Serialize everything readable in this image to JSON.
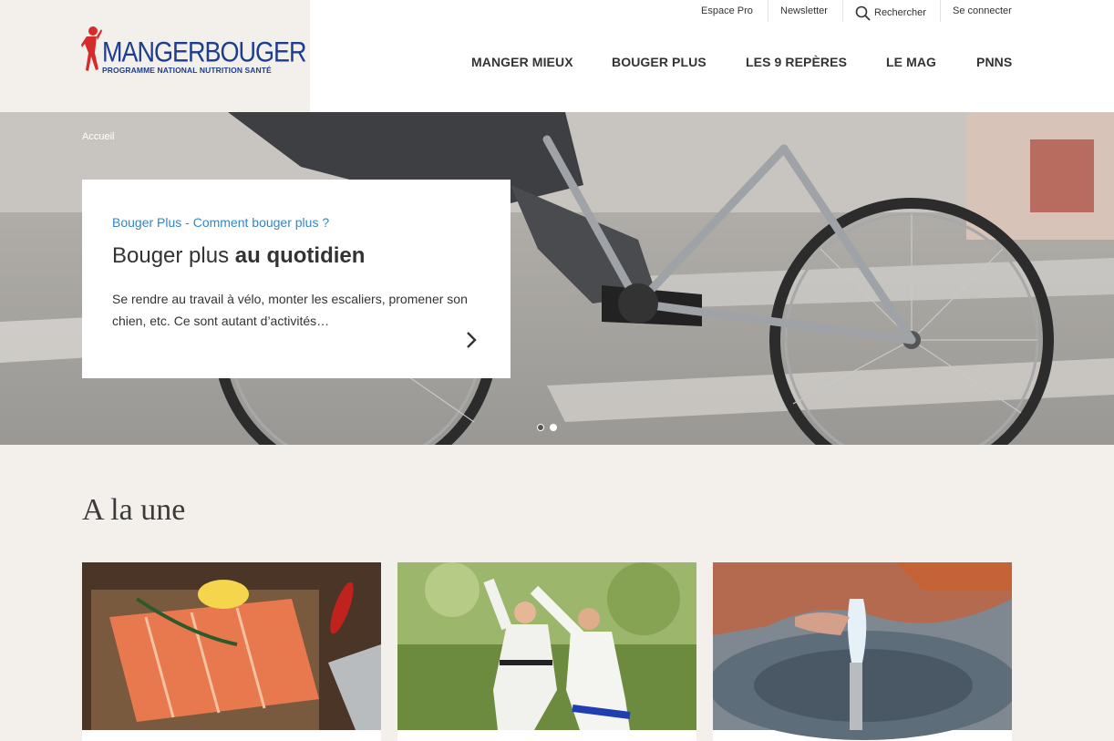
{
  "header": {
    "logo": {
      "title": "MANGERBOUGER",
      "subtitle": "PROGRAMME NATIONAL NUTRITION SANTÉ"
    },
    "utility": {
      "espace_pro": "Espace Pro",
      "newsletter": "Newsletter",
      "search": "Rechercher",
      "login": "Se connecter"
    },
    "nav": [
      "MANGER MIEUX",
      "BOUGER PLUS",
      "LES 9 REPÈRES",
      "LE MAG",
      "PNNS"
    ]
  },
  "hero": {
    "breadcrumb": "Accueil",
    "card": {
      "kicker": "Bouger Plus - Comment bouger plus ?",
      "title_plain": "Bouger plus ",
      "title_bold": "au quotidien",
      "text": "Se rendre au travail à vélo, monter les escaliers, promener son chien, etc. Ce sont autant d’activités…"
    },
    "slides": {
      "total": 2,
      "current": 1
    }
  },
  "section": {
    "title": "A la une"
  },
  "colors": {
    "brand_blue": "#1d3d8f",
    "link_blue": "#3585c5",
    "brand_red": "#d52b2b",
    "page_bg": "#f3f0ec"
  },
  "icons": {
    "search": "search-icon",
    "next": "chevron-right-icon"
  }
}
